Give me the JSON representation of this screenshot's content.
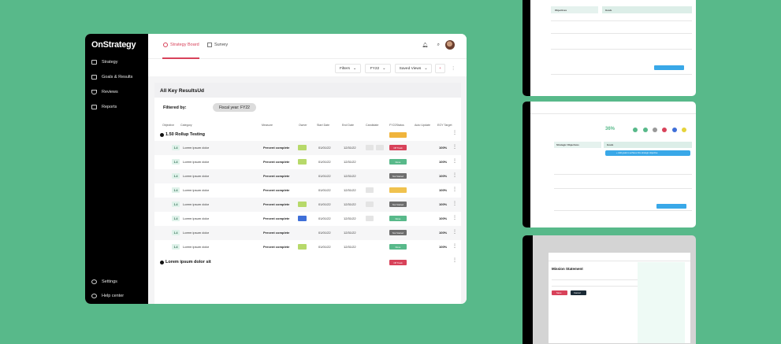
{
  "app": {
    "logo": "OnStrategy"
  },
  "sidebar": {
    "items": [
      {
        "label": "Strategy",
        "icon": "folder-icon"
      },
      {
        "label": "Goals & Results",
        "icon": "stack-icon"
      },
      {
        "label": "Reviews",
        "icon": "shield-icon"
      },
      {
        "label": "Reports",
        "icon": "document-icon"
      }
    ],
    "bottom": [
      {
        "label": "Settings",
        "icon": "gear-icon"
      },
      {
        "label": "Help center",
        "icon": "help-icon"
      }
    ]
  },
  "tabs": [
    {
      "label": "Strategy Board",
      "active": true
    },
    {
      "label": "Survey",
      "active": false
    }
  ],
  "filters": {
    "filters_label": "Filters",
    "year_label": "FY22",
    "saved_views_label": "Saved Views",
    "add_label": "+",
    "more_label": "⋮"
  },
  "panel": {
    "title": "All Key ResultsUd",
    "filtered_by_label": "Filtered by:",
    "filter_chip": "Fiscal year: FY22"
  },
  "table": {
    "columns": [
      "Objective",
      "Category",
      "Measure",
      "Owner",
      "Start Date",
      "End Date",
      "Candidate",
      "FY22Status",
      "Auto Update",
      "EOY Target"
    ],
    "groups": [
      {
        "title": "1.50 Rollup Testing",
        "status": {
          "label": "",
          "color": "#f0b43c"
        },
        "rows": [
          {
            "level": "1.4",
            "name": "Lorem ipsum dolor",
            "measure": "Percent complete",
            "owner_color": "#b7d96a",
            "start": "01/01/22",
            "end": "12/31/22",
            "cands": 2,
            "status_label": "Off Track",
            "status_color": "#d8425a",
            "target": "100%"
          },
          {
            "level": "1.4",
            "name": "Lorem ipsum dolor",
            "measure": "Percent complete",
            "owner_color": "#b7d96a",
            "start": "01/01/22",
            "end": "12/31/22",
            "cands": 0,
            "status_label": "Done",
            "status_color": "#58b98a",
            "target": "100%"
          },
          {
            "level": "1.4",
            "name": "Lorem ipsum dolor",
            "measure": "Percent complete",
            "owner_color": "",
            "start": "01/01/22",
            "end": "12/31/22",
            "cands": 0,
            "status_label": "Not Started",
            "status_color": "#6e6e6e",
            "target": "100%"
          },
          {
            "level": "1.4",
            "name": "Lorem ipsum dolor",
            "measure": "Percent complete",
            "owner_color": "",
            "start": "01/01/22",
            "end": "12/31/22",
            "cands": 1,
            "status_label": "",
            "status_color": "#f0c24e",
            "target": "100%"
          },
          {
            "level": "1.4",
            "name": "Lorem ipsum dolor",
            "measure": "Percent complete",
            "owner_color": "#b7d96a",
            "start": "01/01/22",
            "end": "12/31/22",
            "cands": 1,
            "status_label": "Not Started",
            "status_color": "#6e6e6e",
            "target": "100%"
          },
          {
            "level": "1.4",
            "name": "Lorem ipsum dolor",
            "measure": "Percent complete",
            "owner_color": "#3f6fd8",
            "start": "01/01/22",
            "end": "12/31/22",
            "cands": 1,
            "status_label": "Done",
            "status_color": "#58b98a",
            "target": "100%"
          },
          {
            "level": "1.4",
            "name": "Lorem ipsum dolor",
            "measure": "Percent complete",
            "owner_color": "",
            "start": "01/01/22",
            "end": "12/31/22",
            "cands": 0,
            "status_label": "Not Started",
            "status_color": "#6e6e6e",
            "target": "100%"
          },
          {
            "level": "1.4",
            "name": "Lorem ipsum dolor",
            "measure": "Percent complete",
            "owner_color": "#b7d96a",
            "start": "01/01/22",
            "end": "12/31/22",
            "cands": 0,
            "status_label": "Done",
            "status_color": "#58b98a",
            "target": "100%"
          }
        ]
      },
      {
        "title": "Lorem ipsum dolor sit",
        "status": {
          "label": "Off Track",
          "color": "#d8425a"
        },
        "rows": []
      }
    ]
  },
  "thumbnails": {
    "t1": {
      "col1": "Objectives",
      "col2": "Goals"
    },
    "t2": {
      "col1": "Strategic Objectives",
      "col2": "Goals",
      "big_value": "36%",
      "action": "+ Add goals to achieve this strategic objective"
    },
    "t3": {
      "title": "Mission Statement",
      "primary": "Save",
      "secondary": "Cancel"
    }
  }
}
